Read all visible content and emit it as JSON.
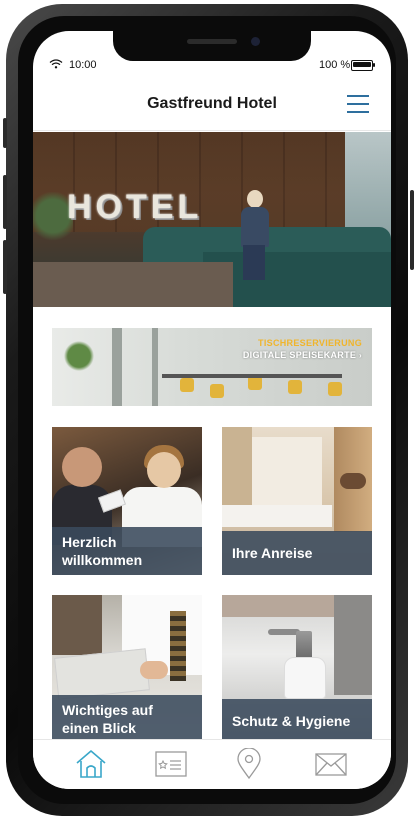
{
  "status_bar": {
    "time": "10:00",
    "battery": "100 %",
    "battery_level": 1.0
  },
  "header": {
    "title": "Gastfreund Hotel"
  },
  "hero": {
    "sign_text": "HOTEL"
  },
  "banner": {
    "line1": "TISCHRESERVIERUNG",
    "line2": "DIGITALE SPEISEKARTE",
    "arrow": "›"
  },
  "tiles": [
    {
      "label_line1": "Herzlich",
      "label_line2": "willkommen"
    },
    {
      "label_line1": "Ihre Anreise",
      "label_line2": ""
    },
    {
      "label_line1": "Wichtiges auf",
      "label_line2": "einen Blick"
    },
    {
      "label_line1": "Schutz & Hygiene",
      "label_line2": ""
    }
  ],
  "bottom_nav": {
    "items": [
      {
        "icon": "home-icon",
        "active": true
      },
      {
        "icon": "ticket-icon",
        "active": false
      },
      {
        "icon": "location-pin-icon",
        "active": false
      },
      {
        "icon": "mail-icon",
        "active": false
      }
    ]
  },
  "colors": {
    "accent": "#3aa7c9",
    "tile_band": "#3a4a5c",
    "banner_highlight": "#f0b52c",
    "menu": "#2e6f9e"
  }
}
